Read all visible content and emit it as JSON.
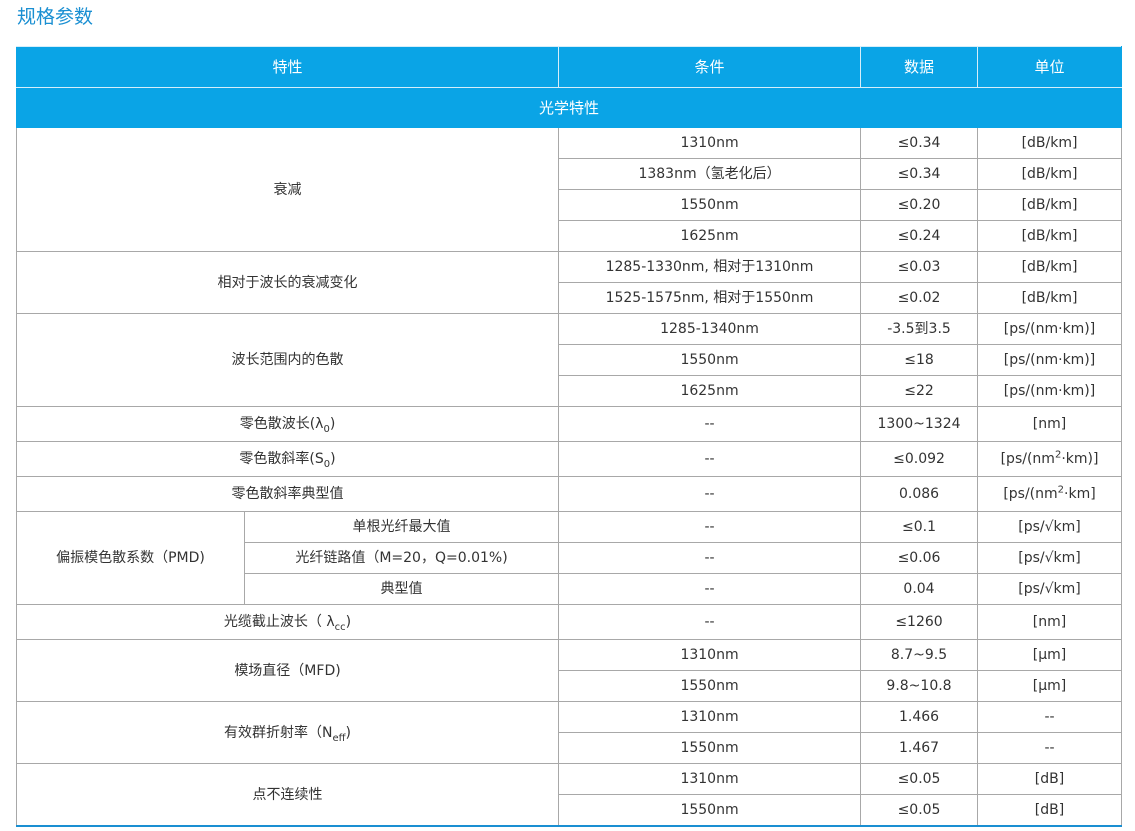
{
  "page": {
    "title": "规格参数"
  },
  "table": {
    "headers": {
      "property": "特性",
      "condition": "条件",
      "data": "数据",
      "unit": "单位"
    },
    "section": "光学特性",
    "attenuation": {
      "label": "衰减",
      "rows": [
        {
          "condition": "1310nm",
          "data": "≤0.34",
          "unit": "[dB/km]"
        },
        {
          "condition": "1383nm（氢老化后）",
          "data": "≤0.34",
          "unit": "[dB/km]"
        },
        {
          "condition": "1550nm",
          "data": "≤0.20",
          "unit": "[dB/km]"
        },
        {
          "condition": "1625nm",
          "data": "≤0.24",
          "unit": "[dB/km]"
        }
      ]
    },
    "attenuation_vs_wavelength": {
      "label": "相对于波长的衰减变化",
      "rows": [
        {
          "condition": "1285-1330nm, 相对于1310nm",
          "data": "≤0.03",
          "unit": "[dB/km]"
        },
        {
          "condition": "1525-1575nm, 相对于1550nm",
          "data": "≤0.02",
          "unit": "[dB/km]"
        }
      ]
    },
    "dispersion": {
      "label": "波长范围内的色散",
      "rows": [
        {
          "condition": "1285-1340nm",
          "data": "-3.5到3.5",
          "unit": "[ps/(nm·km)]"
        },
        {
          "condition": "1550nm",
          "data": "≤18",
          "unit": "[ps/(nm·km)]"
        },
        {
          "condition": "1625nm",
          "data": "≤22",
          "unit": "[ps/(nm·km)]"
        }
      ]
    },
    "zero_dispersion_wavelength": {
      "label": "零色散波长(λ",
      "label_sub": "0",
      "label_end": ")",
      "condition": "--",
      "data": "1300~1324",
      "unit": "[nm]"
    },
    "zero_dispersion_slope": {
      "label": "零色散斜率(S",
      "label_sub": "0",
      "label_end": ")",
      "condition": "--",
      "data": "≤0.092",
      "unit_pre": "[ps/(nm",
      "unit_sup": "2",
      "unit_post": "·km)]"
    },
    "zero_dispersion_slope_typical": {
      "label": "零色散斜率典型值",
      "condition": "--",
      "data": "0.086",
      "unit_pre": "[ps/(nm",
      "unit_sup": "2",
      "unit_post": "·km]"
    },
    "pmd": {
      "label": "偏振模色散系数（PMD)",
      "rows": [
        {
          "sub": "单根光纤最大值",
          "condition": "--",
          "data": "≤0.1",
          "unit": "[ps/√km]"
        },
        {
          "sub": "光纤链路值（M=20，Q=0.01%)",
          "condition": "--",
          "data": "≤0.06",
          "unit": "[ps/√km]"
        },
        {
          "sub": "典型值",
          "condition": "--",
          "data": "0.04",
          "unit": "[ps/√km]"
        }
      ]
    },
    "cable_cutoff": {
      "label": "光缆截止波长（ λ",
      "label_sub": "cc",
      "label_end": ")",
      "condition": "--",
      "data": "≤1260",
      "unit": "[nm]"
    },
    "mfd": {
      "label": "模场直径（MFD)",
      "rows": [
        {
          "condition": "1310nm",
          "data": "8.7~9.5",
          "unit": "[μm]"
        },
        {
          "condition": "1550nm",
          "data": "9.8~10.8",
          "unit": "[μm]"
        }
      ]
    },
    "refractive_index": {
      "label": "有效群折射率（N",
      "label_sub": "eff",
      "label_end": ")",
      "rows": [
        {
          "condition": "1310nm",
          "data": "1.466",
          "unit": "--"
        },
        {
          "condition": "1550nm",
          "data": "1.467",
          "unit": "--"
        }
      ]
    },
    "point_discontinuity": {
      "label": "点不连续性",
      "rows": [
        {
          "condition": "1310nm",
          "data": "≤0.05",
          "unit": "[dB]"
        },
        {
          "condition": "1550nm",
          "data": "≤0.05",
          "unit": "[dB]"
        }
      ]
    }
  },
  "colors": {
    "title": "#1a8fd2",
    "header_bg": "#0aa4e6",
    "border": "#a8a8a8"
  }
}
